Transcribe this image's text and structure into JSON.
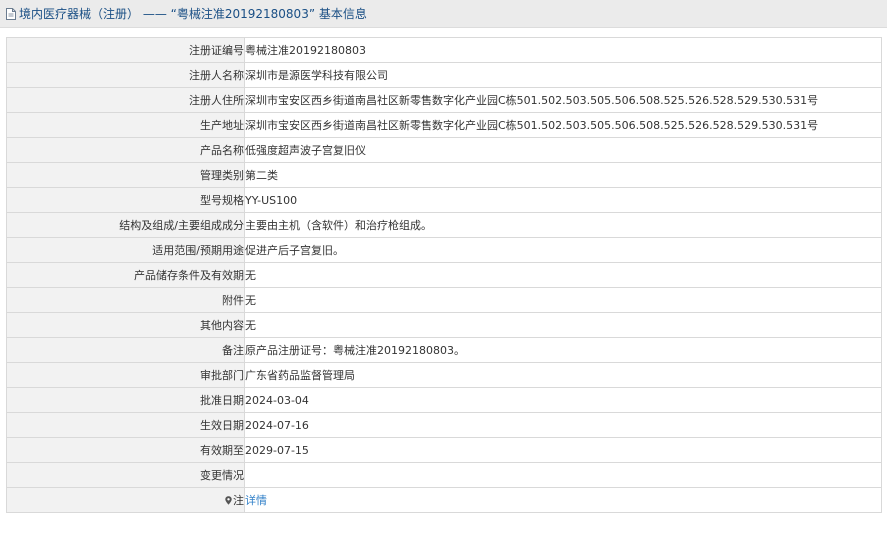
{
  "header": {
    "title": "境内医疗器械（注册） —— “粤械注准20192180803” 基本信息",
    "icon": "document-icon"
  },
  "rows": [
    {
      "label": "注册证编号",
      "value": "粤械注准20192180803"
    },
    {
      "label": "注册人名称",
      "value": "深圳市是源医学科技有限公司"
    },
    {
      "label": "注册人住所",
      "value": "深圳市宝安区西乡街道南昌社区新零售数字化产业园C栋501.502.503.505.506.508.525.526.528.529.530.531号"
    },
    {
      "label": "生产地址",
      "value": "深圳市宝安区西乡街道南昌社区新零售数字化产业园C栋501.502.503.505.506.508.525.526.528.529.530.531号"
    },
    {
      "label": "产品名称",
      "value": "低强度超声波子宫复旧仪"
    },
    {
      "label": "管理类别",
      "value": "第二类"
    },
    {
      "label": "型号规格",
      "value": "YY-US100"
    },
    {
      "label": "结构及组成/主要组成成分",
      "value": "主要由主机（含软件）和治疗枪组成。"
    },
    {
      "label": "适用范围/预期用途",
      "value": "促进产后子宫复旧。"
    },
    {
      "label": "产品储存条件及有效期",
      "value": "无"
    },
    {
      "label": "附件",
      "value": "无"
    },
    {
      "label": "其他内容",
      "value": "无"
    },
    {
      "label": "备注",
      "value": "原产品注册证号：粤械注准20192180803。"
    },
    {
      "label": "审批部门",
      "value": "广东省药品监督管理局"
    },
    {
      "label": "批准日期",
      "value": "2024-03-04"
    },
    {
      "label": "生效日期",
      "value": "2024-07-16"
    },
    {
      "label": "有效期至",
      "value": "2029-07-15"
    },
    {
      "label": "变更情况",
      "value": ""
    }
  ],
  "note_row": {
    "icon": "pin-icon",
    "label": "注",
    "link_text": "详情"
  },
  "colors": {
    "title_text": "#1a4f85",
    "link": "#2f7fc8",
    "label_bg": "#f2f2f2",
    "border": "#d9d9d9"
  }
}
